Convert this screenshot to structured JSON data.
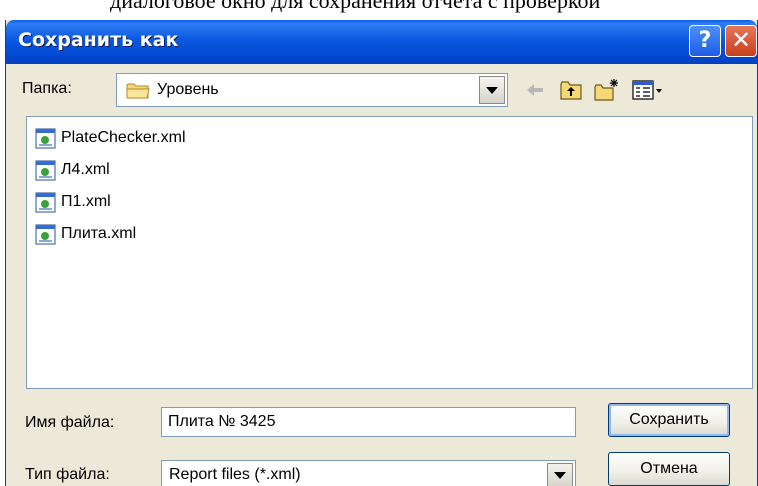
{
  "background_text": "диалоговое окно для сохранения отчета с проверкой",
  "dialog": {
    "title": "Сохранить как",
    "help_glyph": "?",
    "close_glyph": "✕"
  },
  "folder": {
    "label": "Папка:",
    "current": "Уровень"
  },
  "toolbar": {
    "icons": [
      "back-arrow-icon",
      "up-folder-icon",
      "new-folder-icon",
      "views-menu-icon"
    ]
  },
  "files": [
    {
      "name": "PlateChecker.xml"
    },
    {
      "name": "Л4.xml"
    },
    {
      "name": "П1.xml"
    },
    {
      "name": "Плита.xml"
    }
  ],
  "filename": {
    "label": "Имя файла:",
    "value": "Плита № 3425"
  },
  "filetype": {
    "label": "Тип файла:",
    "value": "Report files (*.xml)"
  },
  "buttons": {
    "save": "Сохранить",
    "cancel": "Отмена"
  },
  "colors": {
    "titlebar": "#0a58e0",
    "dialog_bg": "#ece9d8",
    "close_button": "#c8401b"
  }
}
